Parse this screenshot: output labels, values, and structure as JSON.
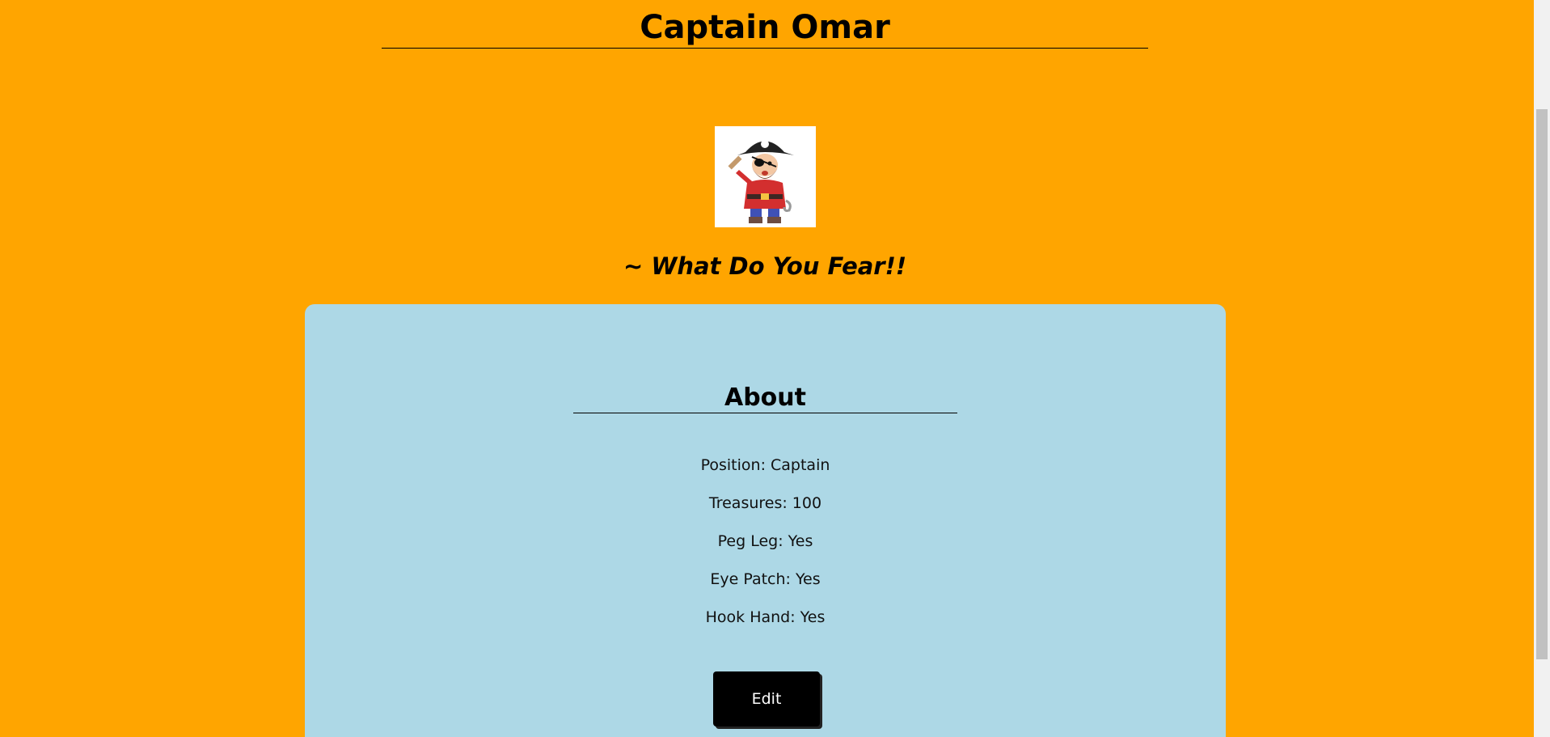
{
  "profile": {
    "name": "Captain Omar",
    "catchphrase": "~ What Do You Fear!!"
  },
  "about": {
    "title": "About",
    "details": [
      {
        "label": "Position: Captain"
      },
      {
        "label": "Treasures: 100"
      },
      {
        "label": "Peg Leg: Yes"
      },
      {
        "label": "Eye Patch: Yes"
      },
      {
        "label": "Hook Hand: Yes"
      }
    ],
    "edit_label": "Edit"
  },
  "colors": {
    "background": "#ffa500",
    "card": "#add8e6",
    "button": "#000000"
  },
  "icons": {
    "avatar": "pirate-avatar"
  }
}
